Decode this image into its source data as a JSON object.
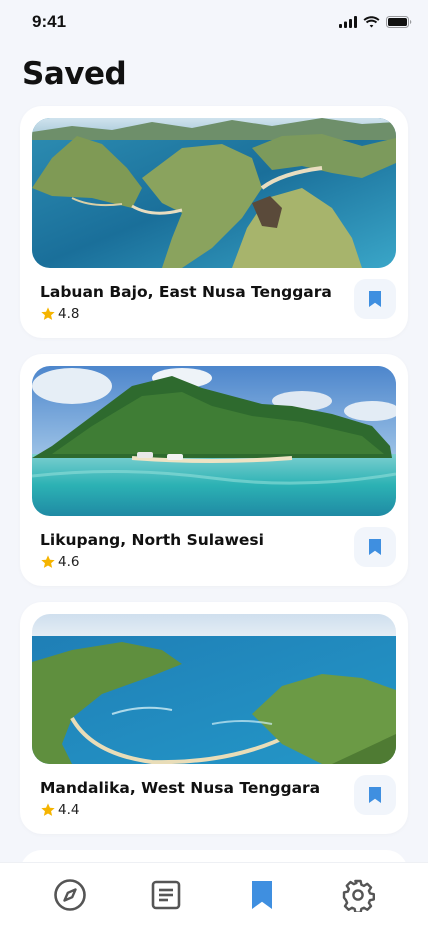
{
  "status_bar": {
    "time": "9:41"
  },
  "page": {
    "title": "Saved"
  },
  "saved_places": [
    {
      "name": "Labuan Bajo, East Nusa Tenggara",
      "rating": "4.8"
    },
    {
      "name": "Likupang, North Sulawesi",
      "rating": "4.6"
    },
    {
      "name": "Mandalika, West Nusa Tenggara",
      "rating": "4.4"
    }
  ],
  "tab_bar": {
    "tabs": [
      {
        "icon": "compass-icon",
        "active": false
      },
      {
        "icon": "article-icon",
        "active": false
      },
      {
        "icon": "bookmark-icon",
        "active": true
      },
      {
        "icon": "gear-icon",
        "active": false
      }
    ]
  },
  "colors": {
    "accent": "#3f8fe0",
    "inactive_icon": "#555555",
    "star": "#f5b400",
    "background": "#f4f6fb"
  }
}
